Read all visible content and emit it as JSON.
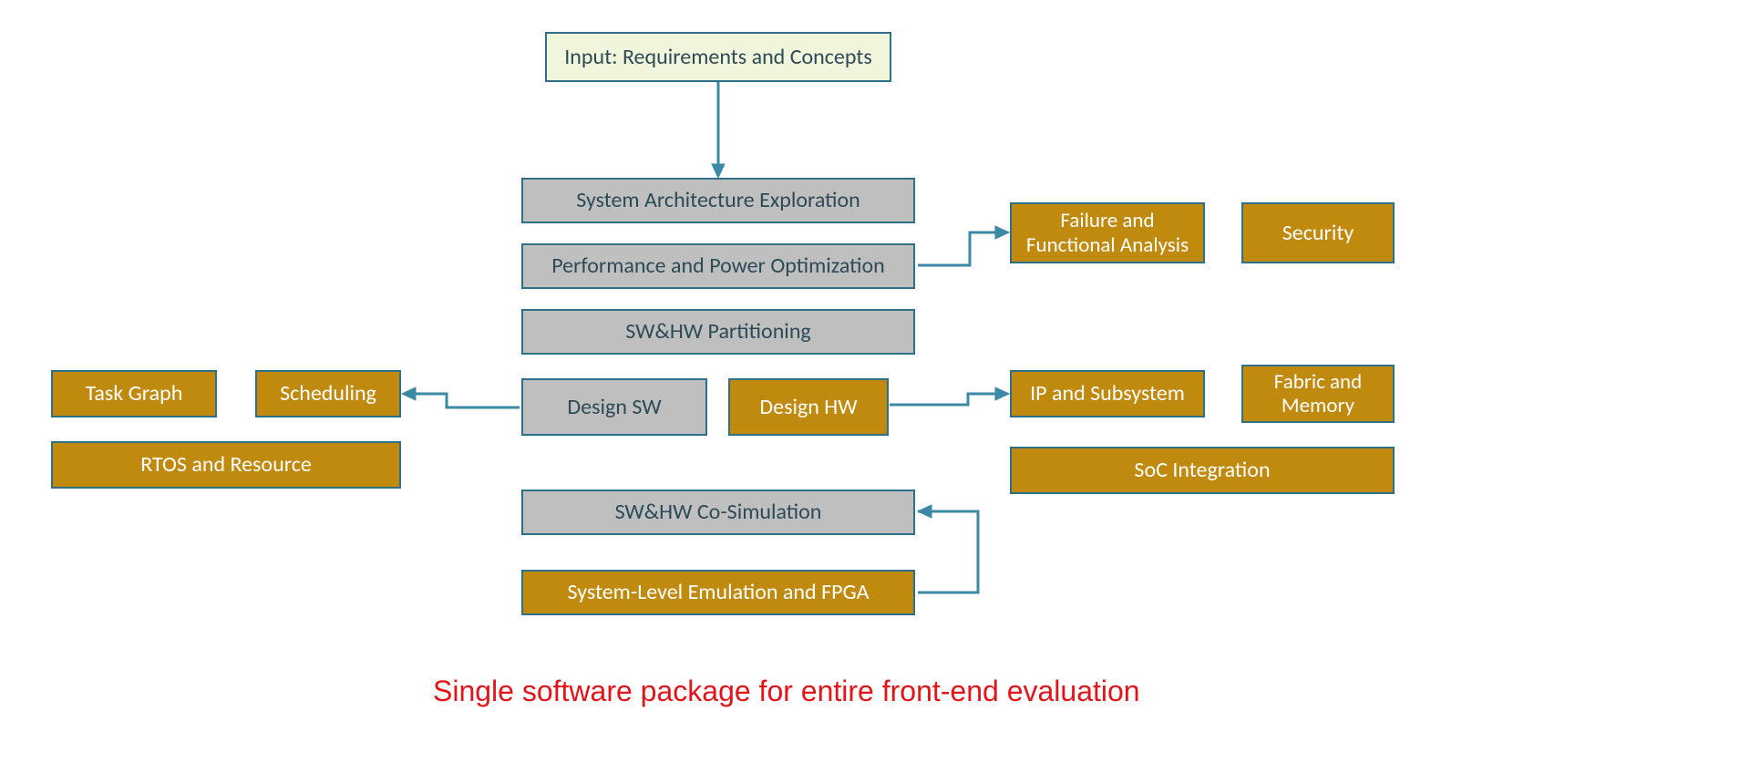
{
  "boxes": {
    "input": "Input: Requirements and Concepts",
    "arch": "System Architecture Exploration",
    "perf": "Performance and Power Optimization",
    "part": "SW&HW Partitioning",
    "dsw": "Design SW",
    "dhw": "Design HW",
    "cosim": "SW&HW Co-Simulation",
    "emul": "System-Level Emulation and FPGA",
    "failure": "Failure and\nFunctional Analysis",
    "security": "Security",
    "sched": "Scheduling",
    "taskgraph": "Task Graph",
    "rtos": "RTOS and Resource",
    "ipsub": "IP and Subsystem",
    "fabric": "Fabric and\nMemory",
    "soc": "SoC Integration"
  },
  "caption": "Single software package for entire front-end evaluation",
  "colors": {
    "border": "#2f6f87",
    "connector": "#3c89a5",
    "green": "#f1f5db",
    "grey": "#bfbfbf",
    "gold": "#c08a0f",
    "caption": "#e3141a"
  }
}
